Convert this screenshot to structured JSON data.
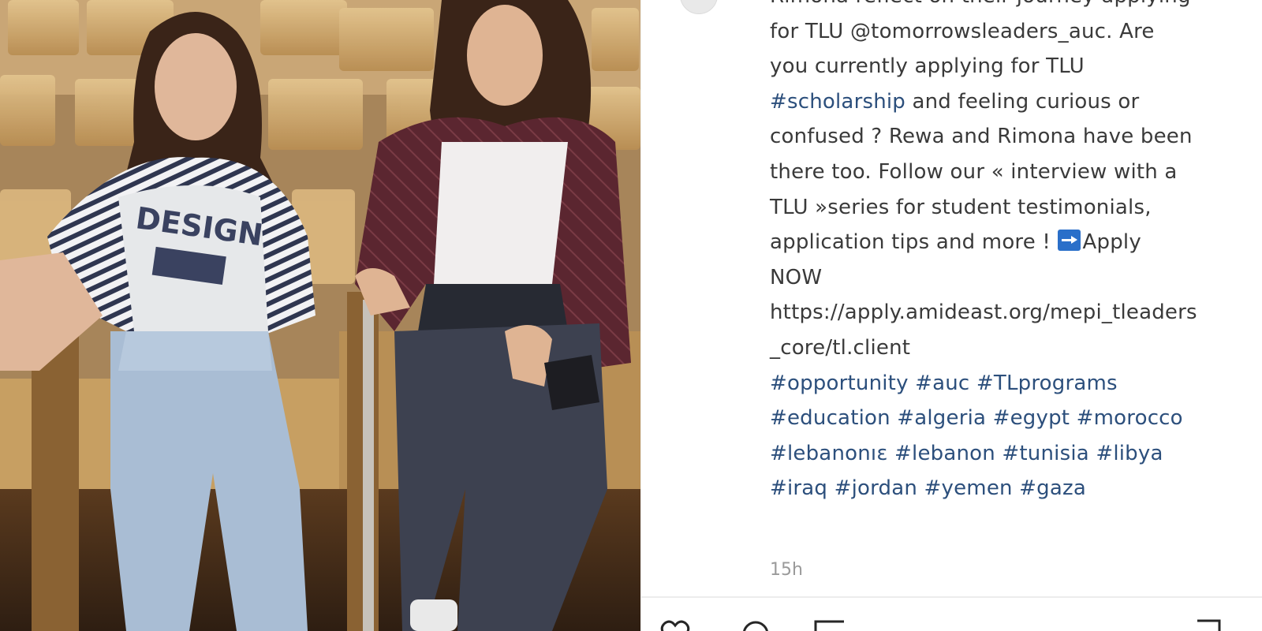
{
  "caption": {
    "lines": [
      [
        {
          "t": "Rimona reflect on their journey applying",
          "c": "text"
        }
      ],
      [
        {
          "t": "for TLU @tomorrowsleaders_auc. Are",
          "c": "text"
        }
      ],
      [
        {
          "t": "you currently applying for TLU",
          "c": "text"
        }
      ],
      [
        {
          "t": "#scholarship",
          "c": "tag"
        },
        {
          "t": " and feeling curious or",
          "c": "text"
        }
      ],
      [
        {
          "t": "confused ? Rewa and Rimona have been",
          "c": "text"
        }
      ],
      [
        {
          "t": "there too. Follow our « interview with a",
          "c": "text"
        }
      ],
      [
        {
          "t": "TLU »series for student testimonials,",
          "c": "text"
        }
      ],
      [
        {
          "t": "application tips and more ! ",
          "c": "text"
        },
        {
          "t": "",
          "c": "emoji"
        },
        {
          "t": "Apply",
          "c": "text"
        }
      ],
      [
        {
          "t": "NOW",
          "c": "text"
        }
      ],
      [
        {
          "t": "https://apply.amideast.org/mepi_tleaders",
          "c": "text"
        }
      ],
      [
        {
          "t": "_core/tl.client",
          "c": "text"
        }
      ],
      [
        {
          "t": "#opportunity #auc #TLprograms",
          "c": "tag"
        }
      ],
      [
        {
          "t": "#education #algeria #egypt #morocco",
          "c": "tag"
        }
      ],
      [
        {
          "t": "#lebanonıɛ #lebanon #tunisia #libya",
          "c": "tag"
        }
      ],
      [
        {
          "t": "#iraq #jordan #yemen #gaza",
          "c": "tag"
        }
      ]
    ]
  },
  "timestamp": "15h",
  "icons": {
    "arrow": "right-arrow-emoji-icon",
    "like": "heart-icon",
    "comment": "comment-icon",
    "share": "share-icon",
    "save": "bookmark-icon"
  },
  "colors": {
    "text": "#3a3a3a",
    "hashtag": "#2c4f7c",
    "timestamp": "#9a9a9a"
  }
}
